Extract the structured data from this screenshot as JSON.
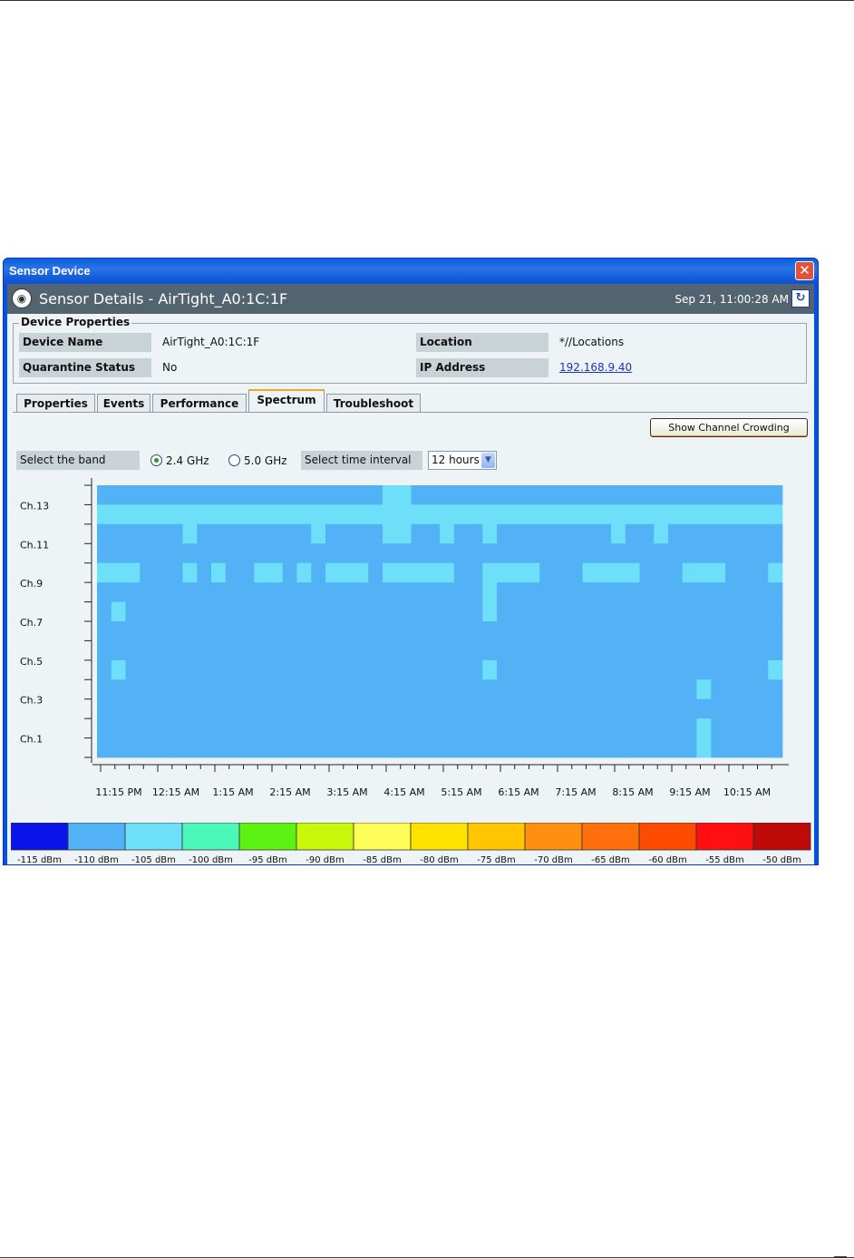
{
  "window": {
    "title": "Sensor Device",
    "close_label": "✕"
  },
  "header": {
    "title": "Sensor Details -  AirTight_A0:1C:1F",
    "datetime": "Sep 21, 11:00:28 AM",
    "icon": "sensor-icon",
    "refresh_icon": "refresh-icon"
  },
  "device_properties": {
    "legend": "Device Properties",
    "device_name_label": "Device Name",
    "device_name": "AirTight_A0:1C:1F",
    "location_label": "Location",
    "location": "*//Locations",
    "quarantine_label": "Quarantine Status",
    "quarantine": "No",
    "ip_label": "IP Address",
    "ip": "192.168.9.40"
  },
  "tabs": [
    {
      "label": "Properties",
      "active": false
    },
    {
      "label": "Events",
      "active": false
    },
    {
      "label": "Performance",
      "active": false
    },
    {
      "label": "Spectrum",
      "active": true
    },
    {
      "label": "Troubleshoot",
      "active": false
    }
  ],
  "toolbar": {
    "channel_crowding_button": "Show Channel Crowding",
    "band_label": "Select the band",
    "band_options": [
      "2.4 GHz",
      "5.0 GHz"
    ],
    "selected_band": "2.4 GHz",
    "interval_label": "Select time interval",
    "interval_value": "12 hours"
  },
  "chart_data": {
    "type": "heatmap",
    "y_labels": [
      "Ch.13",
      "Ch.11",
      "Ch.9",
      "Ch.7",
      "Ch.5",
      "Ch.3",
      "Ch.1"
    ],
    "x_labels": [
      "11:15 PM",
      "12:15 AM",
      "1:15 AM",
      "2:15 AM",
      "3:15 AM",
      "4:15 AM",
      "5:15 AM",
      "6:15 AM",
      "7:15 AM",
      "8:15 AM",
      "9:15 AM",
      "10:15 AM"
    ],
    "rows": 14,
    "cols": 48,
    "base_color": "#52b2f5",
    "highlight_color": "#6edff9",
    "highlight_cells": [
      [
        0,
        20
      ],
      [
        0,
        21
      ],
      [
        1,
        0
      ],
      [
        1,
        1
      ],
      [
        1,
        2
      ],
      [
        1,
        3
      ],
      [
        1,
        4
      ],
      [
        1,
        5
      ],
      [
        1,
        6
      ],
      [
        1,
        7
      ],
      [
        1,
        8
      ],
      [
        1,
        9
      ],
      [
        1,
        10
      ],
      [
        1,
        11
      ],
      [
        1,
        12
      ],
      [
        1,
        13
      ],
      [
        1,
        14
      ],
      [
        1,
        15
      ],
      [
        1,
        16
      ],
      [
        1,
        17
      ],
      [
        1,
        18
      ],
      [
        1,
        19
      ],
      [
        1,
        20
      ],
      [
        1,
        21
      ],
      [
        1,
        22
      ],
      [
        1,
        23
      ],
      [
        1,
        24
      ],
      [
        1,
        25
      ],
      [
        1,
        26
      ],
      [
        1,
        27
      ],
      [
        1,
        28
      ],
      [
        1,
        29
      ],
      [
        1,
        30
      ],
      [
        1,
        31
      ],
      [
        1,
        32
      ],
      [
        1,
        33
      ],
      [
        1,
        34
      ],
      [
        1,
        35
      ],
      [
        1,
        36
      ],
      [
        1,
        37
      ],
      [
        1,
        38
      ],
      [
        1,
        39
      ],
      [
        1,
        40
      ],
      [
        1,
        41
      ],
      [
        1,
        42
      ],
      [
        1,
        43
      ],
      [
        1,
        44
      ],
      [
        1,
        45
      ],
      [
        1,
        46
      ],
      [
        1,
        47
      ],
      [
        2,
        6
      ],
      [
        2,
        15
      ],
      [
        2,
        20
      ],
      [
        2,
        21
      ],
      [
        2,
        24
      ],
      [
        2,
        27
      ],
      [
        2,
        36
      ],
      [
        2,
        39
      ],
      [
        4,
        0
      ],
      [
        4,
        1
      ],
      [
        4,
        2
      ],
      [
        4,
        6
      ],
      [
        4,
        8
      ],
      [
        4,
        11
      ],
      [
        4,
        12
      ],
      [
        4,
        14
      ],
      [
        4,
        16
      ],
      [
        4,
        17
      ],
      [
        4,
        18
      ],
      [
        4,
        20
      ],
      [
        4,
        21
      ],
      [
        4,
        22
      ],
      [
        4,
        23
      ],
      [
        4,
        24
      ],
      [
        4,
        27
      ],
      [
        4,
        28
      ],
      [
        4,
        29
      ],
      [
        4,
        30
      ],
      [
        4,
        34
      ],
      [
        4,
        35
      ],
      [
        4,
        36
      ],
      [
        4,
        37
      ],
      [
        4,
        41
      ],
      [
        4,
        42
      ],
      [
        4,
        43
      ],
      [
        4,
        47
      ],
      [
        5,
        27
      ],
      [
        6,
        1
      ],
      [
        6,
        27
      ],
      [
        9,
        1
      ],
      [
        9,
        27
      ],
      [
        9,
        47
      ],
      [
        10,
        42
      ],
      [
        12,
        42
      ],
      [
        13,
        42
      ]
    ]
  },
  "legend": {
    "colors": [
      "#0a14ea",
      "#52b2f5",
      "#6edff9",
      "#4cf7b9",
      "#5ef214",
      "#c8f70c",
      "#fffe58",
      "#ffe300",
      "#ffc600",
      "#ff8f0e",
      "#ff6f0c",
      "#ff4b00",
      "#ff0f0f",
      "#bf0a0a"
    ],
    "labels": [
      "-115 dBm",
      "-110 dBm",
      "-105 dBm",
      "-100 dBm",
      "-95 dBm",
      "-90 dBm",
      "-85 dBm",
      "-80 dBm",
      "-75 dBm",
      "-70 dBm",
      "-65 dBm",
      "-60 dBm",
      "-55 dBm",
      "-50 dBm"
    ]
  }
}
